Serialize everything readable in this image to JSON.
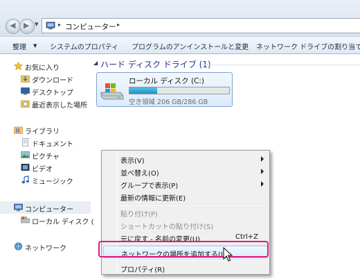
{
  "address": {
    "crumb": "コンピューター",
    "sep": "▸"
  },
  "toolbar": {
    "organize": "整理",
    "system_properties": "システムのプロパティ",
    "uninstall": "プログラムのアンインストールと変更",
    "map_drive": "ネットワーク ドライブの割り当て"
  },
  "nav": {
    "favorites": "お気に入り",
    "downloads": "ダウンロード",
    "desktop": "デスクトップ",
    "recent": "最近表示した場所",
    "libraries": "ライブラリ",
    "documents": "ドキュメント",
    "pictures": "ピクチャ",
    "videos": "ビデオ",
    "music": "ミュージック",
    "computer": "コンピューター",
    "local_disk": "ローカル ディスク (",
    "network": "ネットワーク"
  },
  "content": {
    "group_header": "ハード ディスク ドライブ (1)",
    "drive_name": "ローカル ディスク (C:)",
    "drive_free": "空き領域 206 GB/286 GB",
    "drive_used_fraction": 0.28
  },
  "context_menu": {
    "view": "表示(V)",
    "sort": "並べ替え(O)",
    "group_by": "グループで表示(P)",
    "refresh": "最新の情報に更新(E)",
    "paste": "貼り付け(P)",
    "paste_shortcut": "ショートカットの貼り付け(S)",
    "undo": "元に戻す - 名前の変更(U)",
    "undo_shortcut": "Ctrl+Z",
    "add_network_location": "ネットワークの場所を追加する(L)",
    "properties": "プロパティ(R)"
  },
  "colors": {
    "highlight_box": "#e01a82",
    "group_header": "#1e3287",
    "drive_bar": "#1f93c7"
  }
}
